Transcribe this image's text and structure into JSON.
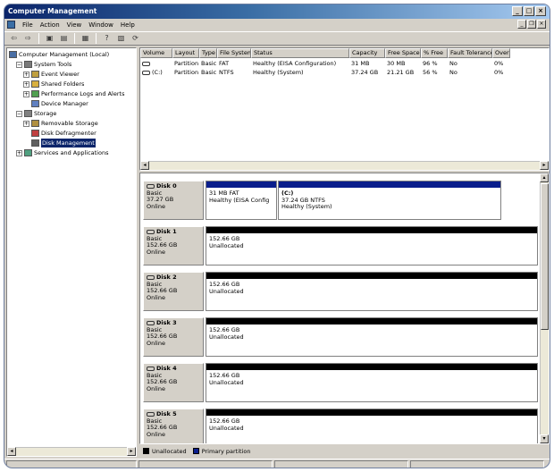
{
  "window": {
    "title": "Computer Management"
  },
  "menu": [
    "File",
    "Action",
    "View",
    "Window",
    "Help"
  ],
  "toolbar": [
    "back",
    "forward",
    "up",
    "show-hide-tree",
    "properties",
    "help",
    "export",
    "refresh"
  ],
  "tree": [
    {
      "label": "Computer Management (Local)",
      "level": 0,
      "expander": "",
      "icon": "computer-icon"
    },
    {
      "label": "System Tools",
      "level": 1,
      "expander": "−",
      "icon": "tools-icon"
    },
    {
      "label": "Event Viewer",
      "level": 2,
      "expander": "+",
      "icon": "event-viewer-icon"
    },
    {
      "label": "Shared Folders",
      "level": 2,
      "expander": "+",
      "icon": "folder-icon"
    },
    {
      "label": "Performance Logs and Alerts",
      "level": 2,
      "expander": "+",
      "icon": "performance-icon"
    },
    {
      "label": "Device Manager",
      "level": 2,
      "expander": "",
      "icon": "device-manager-icon"
    },
    {
      "label": "Storage",
      "level": 1,
      "expander": "−",
      "icon": "storage-icon"
    },
    {
      "label": "Removable Storage",
      "level": 2,
      "expander": "+",
      "icon": "removable-storage-icon"
    },
    {
      "label": "Disk Defragmenter",
      "level": 2,
      "expander": "",
      "icon": "defrag-icon"
    },
    {
      "label": "Disk Management",
      "level": 2,
      "expander": "",
      "icon": "disk-management-icon",
      "selected": true
    },
    {
      "label": "Services and Applications",
      "level": 1,
      "expander": "+",
      "icon": "services-icon"
    }
  ],
  "volume_list": {
    "columns": [
      "Volume",
      "Layout",
      "Type",
      "File System",
      "Status",
      "Capacity",
      "Free Space",
      "% Free",
      "Fault Tolerance",
      "Over"
    ],
    "rows": [
      [
        "",
        "Partition",
        "Basic",
        "FAT",
        "Healthy (EISA Configuration)",
        "31 MB",
        "30 MB",
        "96 %",
        "No",
        "0%"
      ],
      [
        "(C:)",
        "Partition",
        "Basic",
        "NTFS",
        "Healthy (System)",
        "37.24 GB",
        "21.21 GB",
        "56 %",
        "No",
        "0%"
      ]
    ]
  },
  "disks": [
    {
      "name": "Disk 0",
      "type": "Basic",
      "size": "37.27 GB",
      "status": "Online",
      "partitions": [
        {
          "name": "",
          "size": "31 MB FAT",
          "status": "Healthy (EISA Config",
          "kind": "primary"
        },
        {
          "name": "(C:)",
          "size": "37.24 GB NTFS",
          "status": "Healthy (System)",
          "kind": "primary"
        }
      ]
    },
    {
      "name": "Disk 1",
      "type": "Basic",
      "size": "152.66 GB",
      "status": "Online",
      "partitions": [
        {
          "name": "",
          "size": "152.66 GB",
          "status": "Unallocated",
          "kind": "unallocated"
        }
      ]
    },
    {
      "name": "Disk 2",
      "type": "Basic",
      "size": "152.66 GB",
      "status": "Online",
      "partitions": [
        {
          "name": "",
          "size": "152.66 GB",
          "status": "Unallocated",
          "kind": "unallocated"
        }
      ]
    },
    {
      "name": "Disk 3",
      "type": "Basic",
      "size": "152.66 GB",
      "status": "Online",
      "partitions": [
        {
          "name": "",
          "size": "152.66 GB",
          "status": "Unallocated",
          "kind": "unallocated"
        }
      ]
    },
    {
      "name": "Disk 4",
      "type": "Basic",
      "size": "152.66 GB",
      "status": "Online",
      "partitions": [
        {
          "name": "",
          "size": "152.66 GB",
          "status": "Unallocated",
          "kind": "unallocated"
        }
      ]
    },
    {
      "name": "Disk 5",
      "type": "Basic",
      "size": "152.66 GB",
      "status": "Online",
      "partitions": [
        {
          "name": "",
          "size": "152.66 GB",
          "status": "Unallocated",
          "kind": "unallocated"
        }
      ]
    }
  ],
  "legend": [
    {
      "label": "Unallocated",
      "color": "#000000"
    },
    {
      "label": "Primary partition",
      "color": "#0a1e8c"
    }
  ],
  "colors": {
    "primary": "#0a1e8c",
    "unallocated": "#000000"
  }
}
